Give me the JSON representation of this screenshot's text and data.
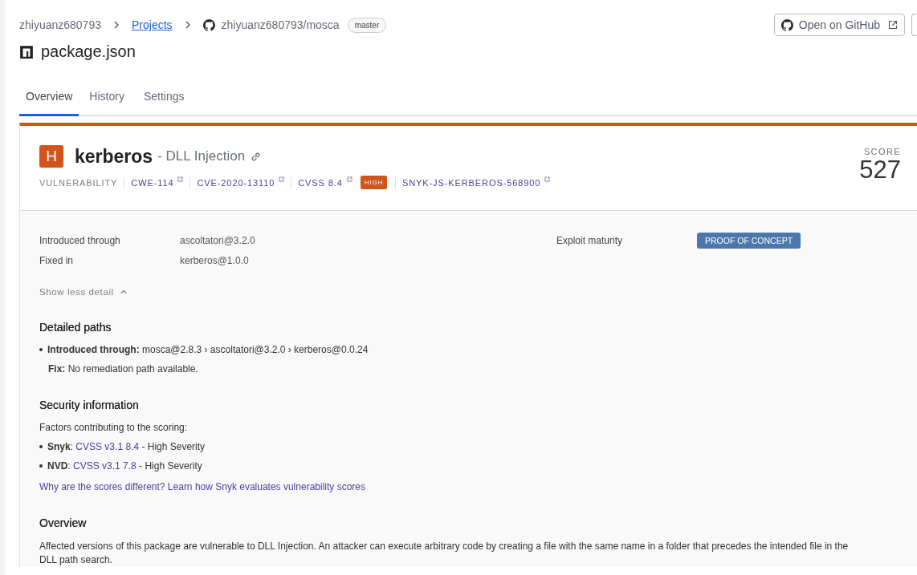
{
  "breadcrumb": [
    {
      "text": "zhiyuanz680793",
      "kind": "text"
    },
    {
      "text": "Projects",
      "kind": "link"
    },
    {
      "text": "zhiyuanz680793/mosca",
      "kind": "repo"
    }
  ],
  "branch": "master",
  "file_title": "package.json",
  "header_button": "Open on GitHub",
  "tabs": [
    {
      "label": "Overview",
      "selected": true
    },
    {
      "label": "History",
      "selected": false
    },
    {
      "label": "Settings",
      "selected": false
    }
  ],
  "issue": {
    "severity_letter": "H",
    "package": "kerberos",
    "title": "- DLL Injection",
    "meta_label": "VULNERABILITY",
    "meta": [
      {
        "text": "CWE-114",
        "kind": "link"
      },
      {
        "text": "CVE-2020-13110",
        "kind": "link"
      },
      {
        "text": "CVSS 8.4",
        "kind": "link"
      },
      {
        "text": "HIGH",
        "kind": "badge"
      },
      {
        "text": "SNYK-JS-KERBEROS-568900",
        "kind": "link"
      }
    ],
    "score_label": "SCORE",
    "score": "527"
  },
  "details": [
    {
      "label": "Introduced through",
      "value": "ascoltatori@3.2.0"
    },
    {
      "label": "Fixed in",
      "value": "kerberos@1.0.0"
    }
  ],
  "exploit": {
    "label": "Exploit maturity",
    "value": "PROOF OF CONCEPT"
  },
  "toggle": "Show less detail",
  "paths": {
    "heading": "Detailed paths",
    "items": [
      {
        "text": "**Introduced through:** mosca@2.8.3 › ascoltatori@3.2.0 › kerberos@0.0.24",
        "fix": "**Fix:** No remediation path available."
      }
    ]
  },
  "security": {
    "heading": "Security information",
    "intro": "Factors contributing to the scoring:",
    "items": [
      {
        "source": "**Snyk**: ",
        "link": "CVSS v3.1 8.4",
        "suffix": " - High Severity"
      },
      {
        "source": "**NVD**: ",
        "link": "CVSS v3.1 7.8",
        "suffix": " - High Severity"
      }
    ],
    "link": "Why are the scores different? Learn how Snyk evaluates vulnerability scores"
  },
  "overview": {
    "heading": "Overview",
    "text": "Affected versions of this package are vulnerable to DLL Injection. An attacker can execute arbitrary code by creating a file with the same name in a folder that precedes the intended file in the DLL path search."
  }
}
